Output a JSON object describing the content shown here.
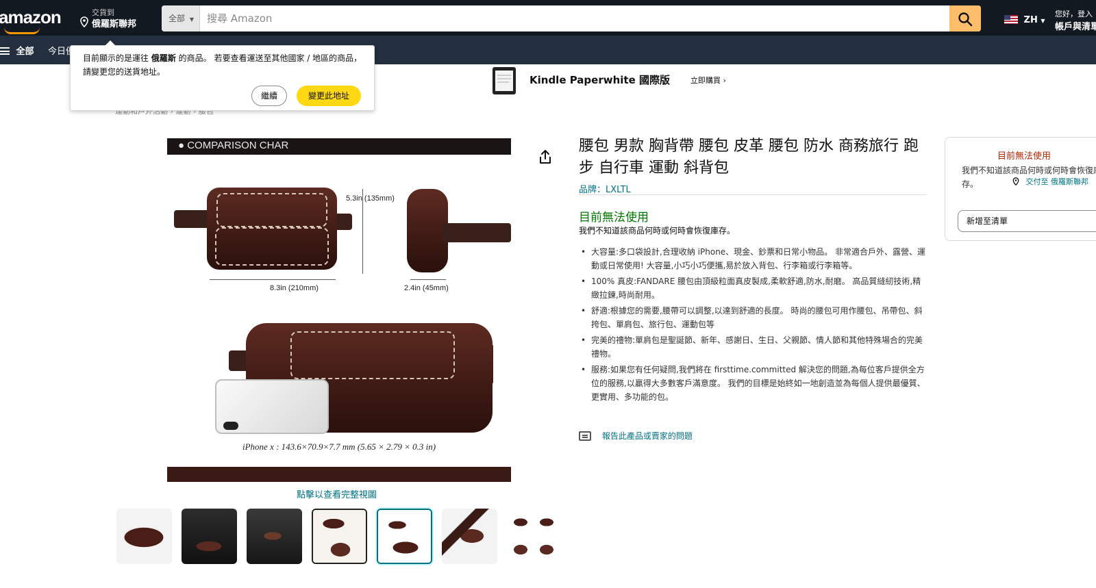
{
  "header": {
    "logo": "amazon",
    "deliver_to_label": "交貨到",
    "deliver_to_location": "俄羅斯聯邦",
    "search_category": "全部",
    "search_placeholder": "搜尋 Amazon",
    "language": "ZH",
    "account_greeting": "您好，登入",
    "account_lists": "帳戶與清單"
  },
  "subnav": {
    "all_label": "全部",
    "today_label": "今日優"
  },
  "popover": {
    "message_part1": "目前顯示的是運往 ",
    "message_bold": "俄羅斯",
    "message_part2": " 的商品。 若要查看運送至其他國家 / 地區的商品，請變更您的送貨地址。",
    "continue_label": "繼續",
    "change_label": "變更此地址"
  },
  "banner": {
    "title": "Kindle Paperwhite 國際版",
    "buy_label": "立即購買 ›"
  },
  "breadcrumb": "運動和戶外活動 › 運動 › 腰包",
  "image": {
    "header_text": "● COMPARISON CHAR",
    "height_label": "5.3in (135mm)",
    "width_label": "8.3in (210mm)",
    "depth_label": "2.4in (45mm)",
    "caption": "iPhone x : 143.6×70.9×7.7 mm  (5.65 × 2.79 × 0.3 in)",
    "full_view_link": "點擊以查看完整視圖"
  },
  "thumbnails": [
    {
      "label": "thumb-1",
      "selected": false
    },
    {
      "label": "thumb-2",
      "selected": false
    },
    {
      "label": "thumb-3",
      "selected": false
    },
    {
      "label": "thumb-4",
      "selected": false
    },
    {
      "label": "thumb-5",
      "selected": true
    },
    {
      "label": "thumb-6",
      "selected": false
    },
    {
      "label": "thumb-7",
      "selected": false
    }
  ],
  "product": {
    "title": "腰包 男款 胸背帶 腰包 皮革 腰包 防水 商務旅行 跑步 自行車 運動 斜背包",
    "brand": "品牌：LXLTL",
    "availability": "目前無法使用",
    "restock_note": "我們不知道該商品何時或何時會恢復庫存。",
    "bullets": [
      "大容量:多口袋設計,合理收納 iPhone、現金、鈔票和日常小物品。 非常適合戶外、露營、運動或日常使用! 大容量,小巧小巧便攜,易於放入背包、行李箱或行李箱等。",
      "100% 真皮:FANDARE 腰包由頂級粒面真皮製成,柔軟舒適,防水,耐磨。 高品質縫紉技術,精緻拉鍊,時尚耐用。",
      "舒適:根據您的需要,腰帶可以調整,以達到舒適的長度。 時尚的腰包可用作腰包、吊帶包、斜挎包、單肩包、旅行包、運動包等",
      "完美的禮物:單肩包是聖誕節、新年、感謝日、生日、父親節、情人節和其他特殊場合的完美禮物。",
      "服務:如果您有任何疑問,我們將在 firsttime.committed 解決您的問題,為每位客戶提供全方位的服務,以贏得大多數客戶滿意度。 我們的目標是始終如一地創造並為每個人提供最優質、更實用、多功能的包。"
    ],
    "report_link": "報告此產品或賣家的問題"
  },
  "buybox": {
    "unavailable": "目前無法使用",
    "restock_text": "我們不知道該商品何時或何時會恢復庫存。",
    "deliver_link": "交付至 俄羅斯聯邦",
    "add_to_list": "新增至清單"
  },
  "colors": {
    "nav_dark": "#131921",
    "nav_sub": "#232f3e",
    "search_button": "#febd69",
    "primary_button": "#ffd814",
    "link": "#007185",
    "availability_green": "#007600",
    "price_red": "#b12704"
  }
}
